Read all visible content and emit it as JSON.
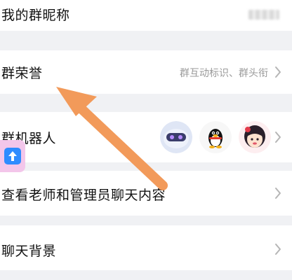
{
  "rows": {
    "nickname": {
      "label": "我的群昵称",
      "icon": "chevron-right-icon"
    },
    "honor": {
      "label": "群荣誉",
      "value": "群互动标识、群头衔",
      "icon": "chevron-right-icon"
    },
    "robot": {
      "label": "群机器人",
      "avatars": [
        "robot-avatar-icon",
        "qq-penguin-avatar-icon",
        "girl-avatar-icon"
      ],
      "icon": "chevron-right-icon"
    },
    "chat_content": {
      "label": "查看老师和管理员聊天内容",
      "icon": "chevron-right-icon"
    },
    "background": {
      "label": "聊天背景",
      "icon": "chevron-right-icon"
    }
  },
  "floating_badge": {
    "icon": "arrow-up-app-icon"
  },
  "annotation": {
    "type": "arrow",
    "color": "#f29a5a"
  },
  "colors": {
    "page_bg": "#f0f1f4",
    "row_bg": "#ffffff",
    "text": "#111111",
    "subtext": "#9a9a9a"
  }
}
